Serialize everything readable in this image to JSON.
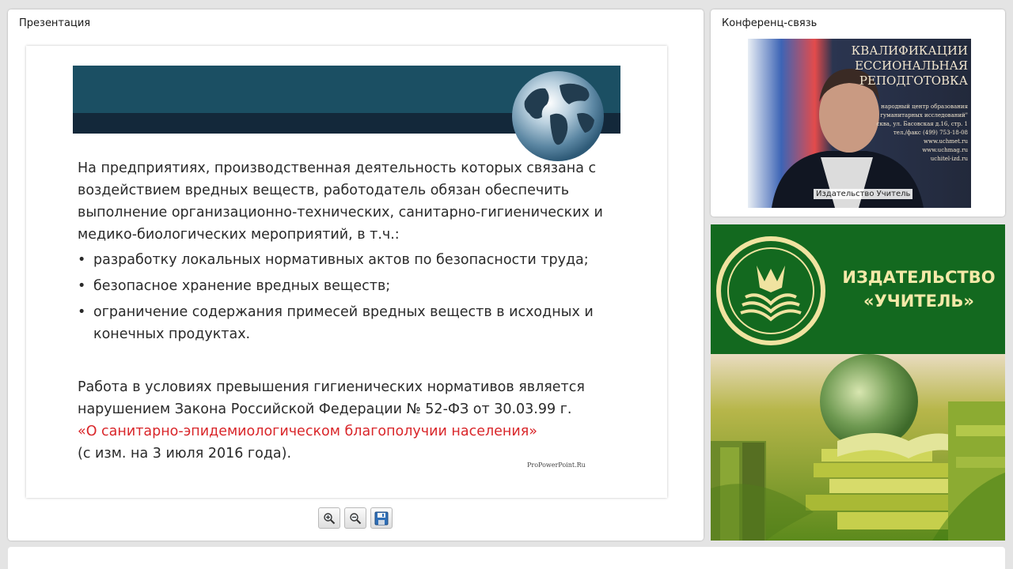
{
  "presentation": {
    "title": "Презентация",
    "slide": {
      "intro": "На предприятиях, производственная деятельность которых связана с воздействием вредных веществ, работодатель обязан обеспечить выполнение организационно-технических, санитарно-гигиенических и медико-биологических мероприятий, в т.ч.:",
      "bullets": [
        "разработку локальных нормативных актов по безопасности труда;",
        "безопасное хранение вредных веществ;",
        "ограничение содержания примесей вредных веществ в исходных и конечных продуктах."
      ],
      "law_text": "Работа в условиях превышения гигиенических нормативов является нарушением Закона Российской Федерации № 52-ФЗ от 30.03.99 г.",
      "law_link": "«О санитарно-эпидемиологическом благополучии населения»",
      "law_note": "(с изм. на 3 июля 2016 года).",
      "footer": "ProPowerPoint.Ru",
      "bullet_char": "•"
    },
    "toolbar": {
      "zoom_in_icon": "zoom-in-icon",
      "zoom_out_icon": "zoom-out-icon",
      "save_icon": "floppy-disk-icon"
    }
  },
  "conference": {
    "title": "Конференц-связь",
    "caption": "Издательство Учитель",
    "background_lines": [
      "КВАЛИФИКАЦИИ",
      "ЕССИОНАЛЬНАЯ",
      "РЕПОДГОТОВКА"
    ],
    "background_small": [
      "народный центр образования",
      "гуманитарных исследований\"",
      "сква, ул. Басовская д.16, стр. 1",
      "тел./факс (499) 753-18-08",
      "www.uchmet.ru",
      "www.uchmag.ru",
      "uchitel-izd.ru"
    ]
  },
  "publisher": {
    "name_line1": "ИЗДАТЕЛЬСТВО",
    "name_line2": "«УЧИТЕЛЬ»"
  },
  "colors": {
    "slide_band": "#1b4f63",
    "slide_band_dark": "#13283a",
    "law_link": "#d9262a",
    "publisher_green": "#13691f",
    "publisher_text": "#f4e9a8"
  }
}
